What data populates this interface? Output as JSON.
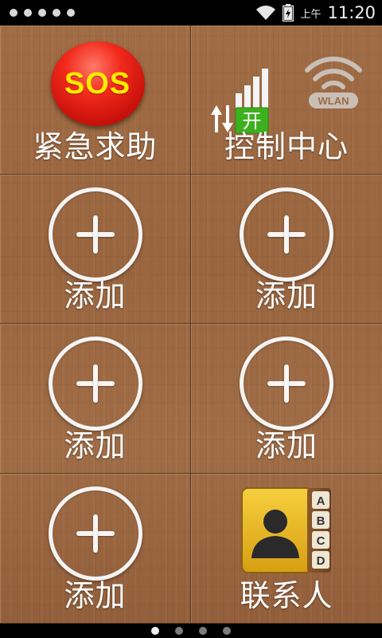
{
  "status_bar": {
    "notification_dots": 5,
    "icons": [
      "wifi-icon",
      "battery-charging-icon"
    ],
    "ampm": "上午",
    "time": "11:20"
  },
  "tiles": [
    {
      "label": "紧急求助",
      "icon": "sos-icon",
      "icon_text": "SOS"
    },
    {
      "label": "控制中心",
      "icon": "signal-toggle-icon",
      "icon_text": "开",
      "secondary_icon": "wlan-icon",
      "secondary_icon_text": "WLAN"
    },
    {
      "label": "添加",
      "icon": "add-icon"
    },
    {
      "label": "添加",
      "icon": "add-icon"
    },
    {
      "label": "添加",
      "icon": "add-icon"
    },
    {
      "label": "添加",
      "icon": "add-icon"
    },
    {
      "label": "添加",
      "icon": "add-icon"
    },
    {
      "label": "联系人",
      "icon": "contacts-book-icon",
      "tab_letters": [
        "A",
        "B",
        "C",
        "D"
      ]
    }
  ],
  "page_indicator": {
    "pages": 4,
    "active": 0
  },
  "colors": {
    "wood": "#9e6a44",
    "sos_red": "#e8231a",
    "sos_text": "#ffea00",
    "toggle_green": "#3db01f"
  }
}
